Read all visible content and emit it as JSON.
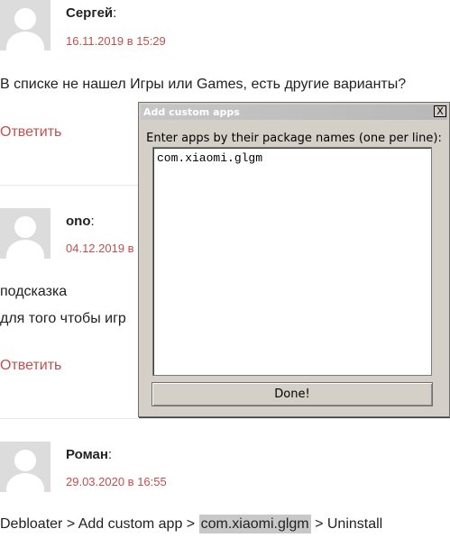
{
  "comments": [
    {
      "author": "Сергей",
      "date": "16.11.2019 в 15:29",
      "text": "В списке не нашел Игры или Games, есть другие варианты?",
      "reply": "Ответить"
    },
    {
      "author": "ono",
      "date": "04.12.2019 в",
      "line1": "подсказка",
      "line2": "для того чтобы игр",
      "reply": "Ответить"
    },
    {
      "author": "Роман",
      "date": "29.03.2020 в 16:55",
      "text_before": "Debloater > Add custom app > ",
      "text_highlight": "com.xiaomi.glgm",
      "text_after": " > Uninstall"
    }
  ],
  "colon": ":",
  "dialog": {
    "title": "Add custom apps",
    "close": "X",
    "prompt": "Enter apps by their package names (one per line):",
    "textarea_value": "com.xiaomi.glgm",
    "done": "Done!"
  }
}
